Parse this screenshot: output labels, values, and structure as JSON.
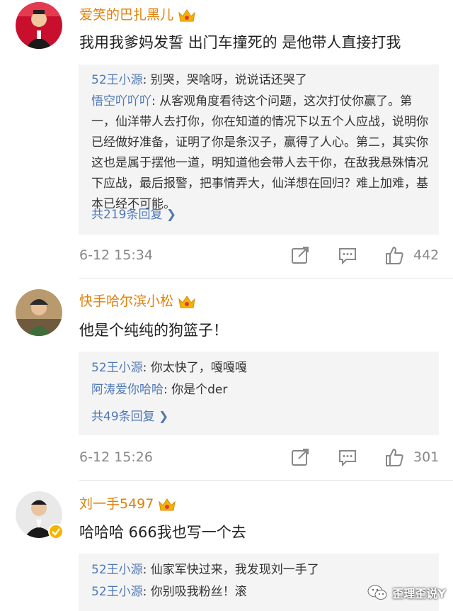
{
  "comments": [
    {
      "username": "爱笑的巴扎黑儿",
      "content": "我用我爹妈发誓 出门车撞死的 是他带人直接打我",
      "replies": [
        {
          "who": "52王小源",
          "text": "别哭，哭啥呀，说说话还哭了"
        },
        {
          "who": "悟空吖吖吖",
          "text": "从客观角度看待这个问题，这次打仗你赢了。第一，仙洋带人去打你，你在知道的情况下以五个人应战，说明你已经做好准备，证明了你是条汉子，赢得了人心。第二，其实你这也是属于摆他一道，明知道他会带人去干你，在敌我悬殊情况下应战，最后报警，把事情弄大，仙洋想在回归？难上加难，基本已经不可能。"
        }
      ],
      "more": "共219条回复",
      "time": "6-12 15:34",
      "likes": "442"
    },
    {
      "username": "快手哈尔滨小松",
      "content": "他是个纯纯的狗篮子！",
      "replies": [
        {
          "who": "52王小源",
          "text": "你太快了，嘎嘎嘎"
        },
        {
          "who": "阿涛爱你哈哈",
          "text": "你是个der"
        }
      ],
      "more": "共49条回复",
      "time": "6-12 15:26",
      "likes": "301"
    },
    {
      "username": "刘一手5497",
      "content": "哈哈哈 666我也写一个去",
      "replies": [
        {
          "who": "52王小源",
          "text": "仙家军快过来，我发现刘一手了"
        },
        {
          "who": "52王小源",
          "text": "你别吸我粉丝！滚"
        }
      ]
    }
  ],
  "icons": {
    "crown": "crown-badge-icon",
    "repost": "repost-icon",
    "comment": "comment-icon",
    "like": "thumbs-up-icon",
    "verified": "verified-badge-icon"
  },
  "colors": {
    "username": "#e0800a",
    "reply_name": "#4f79b5",
    "reply_bg": "#f4f4f4",
    "meta": "#888888"
  },
  "watermark": {
    "text": "歪理歪说Y"
  }
}
